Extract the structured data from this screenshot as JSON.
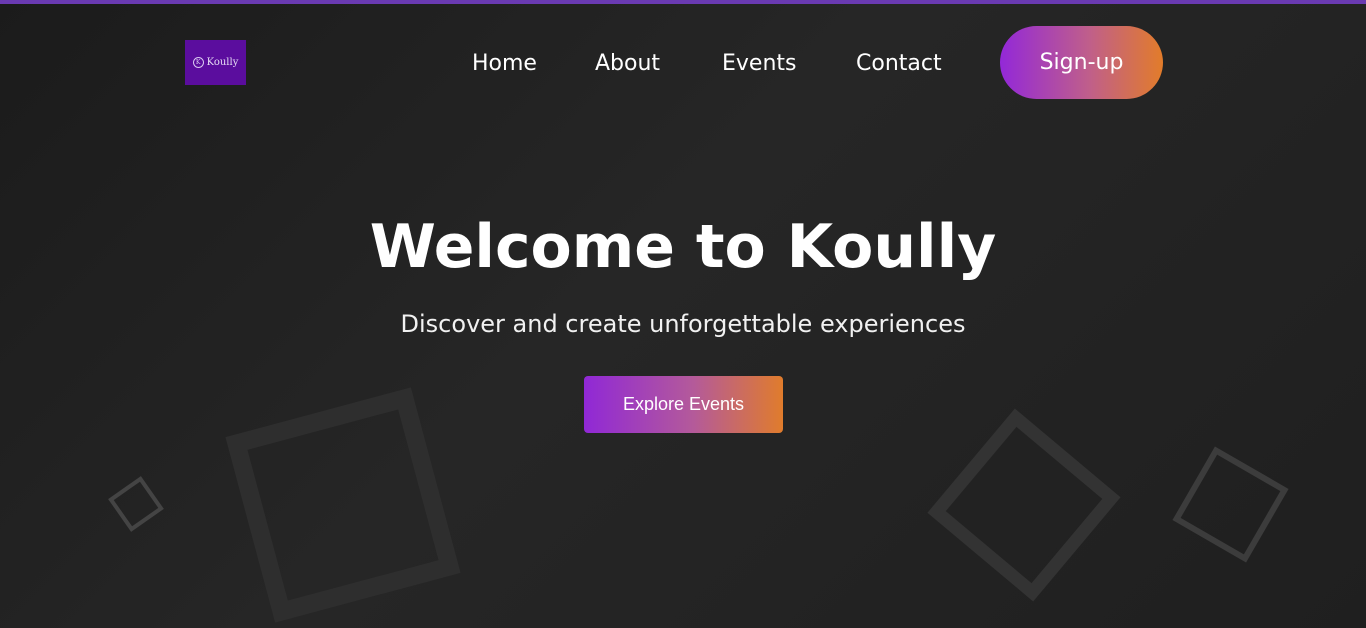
{
  "brand": {
    "logo_text": "Koully",
    "logo_mark": "K",
    "logo_bg": "#5b0d9e"
  },
  "nav": {
    "links": [
      {
        "label": "Home"
      },
      {
        "label": "About"
      },
      {
        "label": "Events"
      },
      {
        "label": "Contact"
      }
    ],
    "signup_label": "Sign-up"
  },
  "hero": {
    "title": "Welcome to Koully",
    "subtitle": "Discover and create unforgettable experiences",
    "cta_label": "Explore Events"
  },
  "colors": {
    "accent_start": "#9328d8",
    "accent_end": "#e27c2a",
    "background": "#222222",
    "top_bar": "#6a3ab2"
  }
}
